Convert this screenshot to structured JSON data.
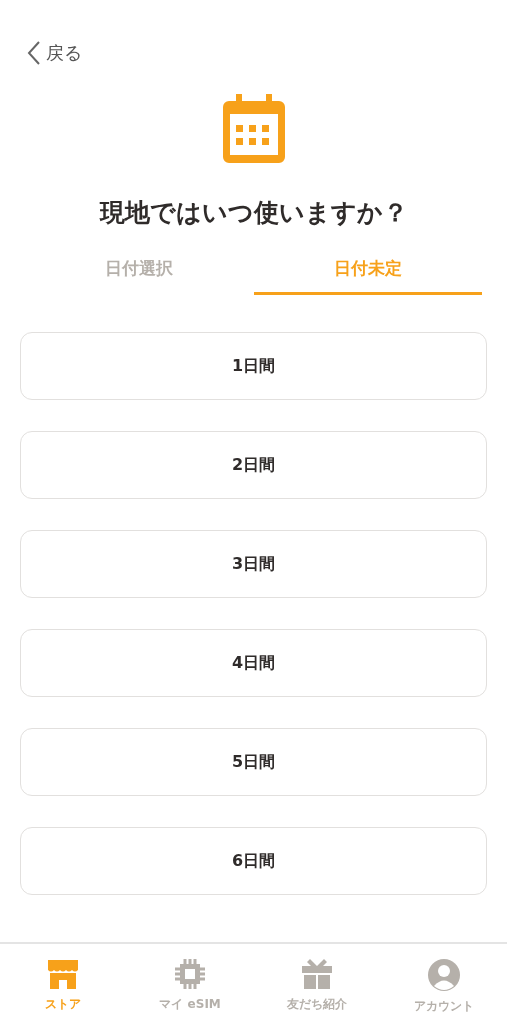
{
  "back": {
    "label": "戻る"
  },
  "title": "現地ではいつ使いますか？",
  "tabs": [
    {
      "label": "日付選択",
      "selected": false
    },
    {
      "label": "日付未定",
      "selected": true
    }
  ],
  "options": [
    "1日間",
    "2日間",
    "3日間",
    "4日間",
    "5日間",
    "6日間"
  ],
  "nav": [
    {
      "kind": "store",
      "label": "ストア",
      "selected": true
    },
    {
      "kind": "chip",
      "label": "マイ eSIM",
      "selected": false
    },
    {
      "kind": "gift",
      "label": "友だち紹介",
      "selected": false
    },
    {
      "kind": "account",
      "label": "アカウント",
      "selected": false
    }
  ]
}
